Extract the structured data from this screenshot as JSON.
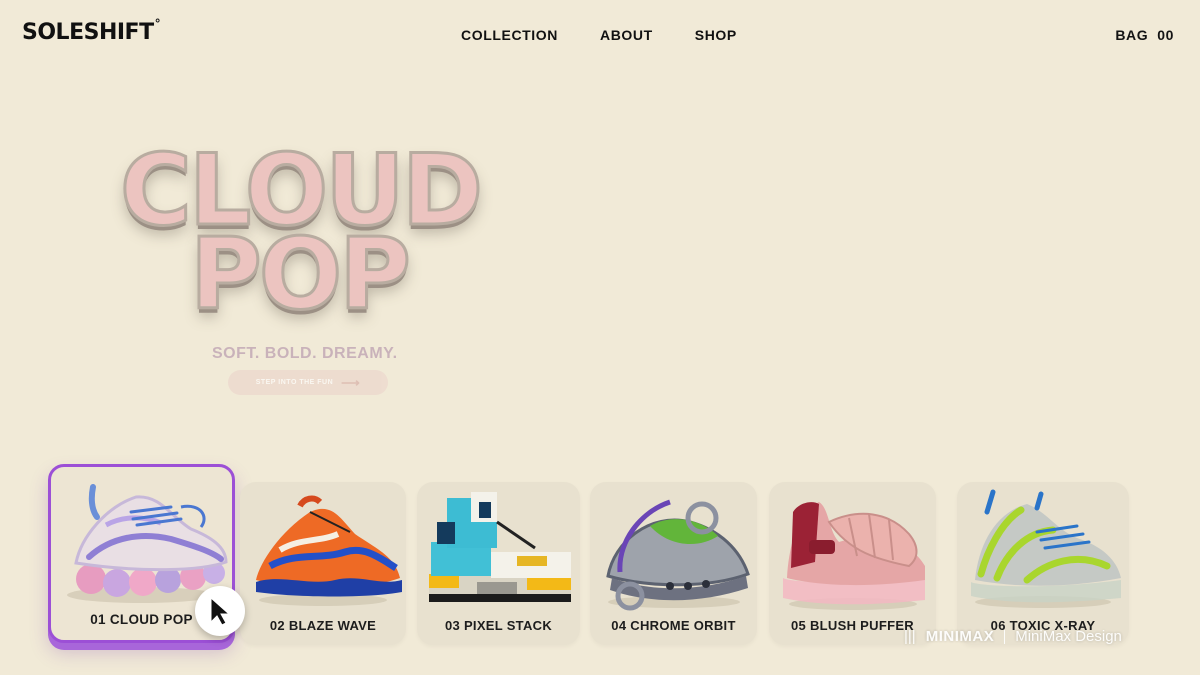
{
  "brand": {
    "name": "SOLESHIFT",
    "mark": "°"
  },
  "nav": [
    {
      "label": "COLLECTION"
    },
    {
      "label": "ABOUT"
    },
    {
      "label": "SHOP"
    }
  ],
  "bag": {
    "label": "BAG",
    "count": "00"
  },
  "hero": {
    "line1": "CLOUD",
    "line2": "POP",
    "tagline": "SOFT. BOLD. DREAMY.",
    "cta_label": "STEP INTO THE FUN"
  },
  "products": [
    {
      "label": "01 CLOUD POP",
      "selected": true
    },
    {
      "label": "02 BLAZE WAVE",
      "selected": false
    },
    {
      "label": "03 PIXEL STACK",
      "selected": false
    },
    {
      "label": "04 CHROME ORBIT",
      "selected": false
    },
    {
      "label": "05 BLUSH PUFFER",
      "selected": false
    },
    {
      "label": "06 TOXIC X-RAY",
      "selected": false
    }
  ],
  "watermark": {
    "left": "MINIMAX",
    "right": "MiniMax Design"
  },
  "colors": {
    "background": "#f1ead7",
    "accent": "#9c4fd6",
    "hero_fill": "#ecc4c0",
    "tagline": "#c3a9b6"
  }
}
